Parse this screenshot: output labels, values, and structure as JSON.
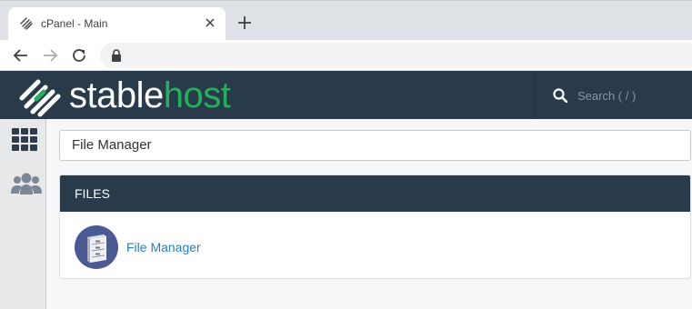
{
  "browser": {
    "tab_title": "cPanel - Main",
    "icons": {
      "favicon": "cpanel-favicon-icon",
      "close": "close-icon",
      "new_tab": "plus-icon",
      "back": "arrow-left-icon",
      "forward": "arrow-right-icon",
      "reload": "reload-icon",
      "lock": "lock-icon"
    }
  },
  "header": {
    "logo_stable": "stable",
    "logo_host": "host",
    "search_placeholder": "Search ( / )",
    "colors": {
      "bar": "#293a4a",
      "brand_green": "#23b05c"
    }
  },
  "sidebar": {
    "items": [
      {
        "icon": "grid-icon"
      },
      {
        "icon": "users-icon"
      }
    ]
  },
  "main": {
    "search_value": "File Manager",
    "panel": {
      "title": "FILES",
      "items": [
        {
          "label": "File Manager",
          "icon": "file-cabinet-icon"
        }
      ]
    }
  }
}
